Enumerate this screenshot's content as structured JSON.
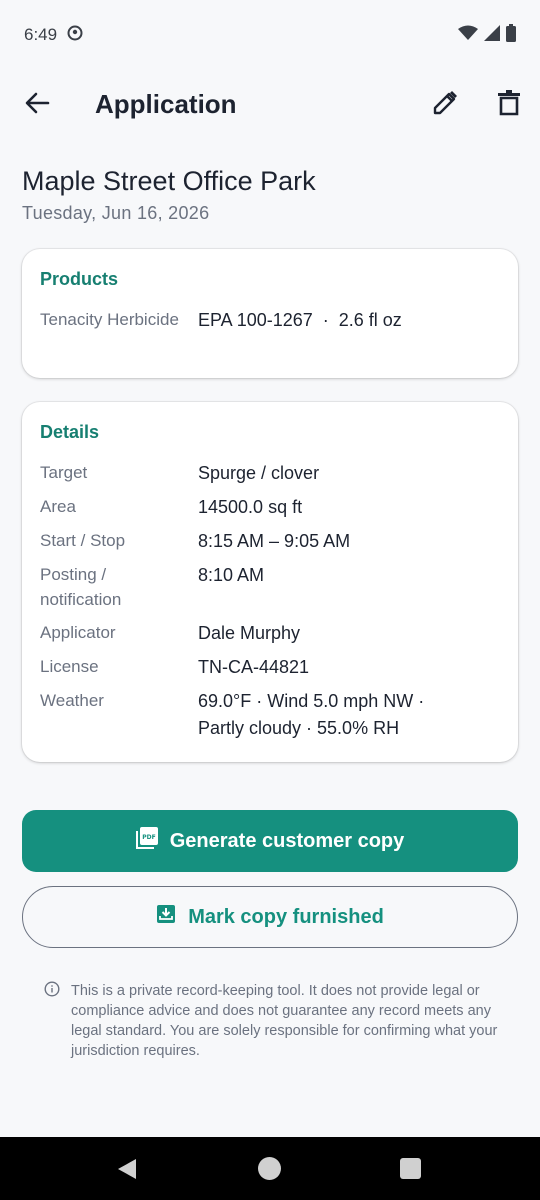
{
  "status_bar": {
    "time": "6:49",
    "icons": [
      "face-icon",
      "wifi-icon",
      "signal-icon",
      "battery-icon"
    ]
  },
  "app_bar": {
    "title": "Application",
    "icons": [
      "back-arrow-icon",
      "edit-pencil-icon",
      "trash-icon"
    ]
  },
  "header": {
    "site": "Maple Street Office Park",
    "date": "Tuesday, Jun 16, 2026"
  },
  "products": {
    "title": "Products",
    "items": [
      {
        "label": "Tenacity Herbicide",
        "value": "EPA 100-1267  ·  2.6 fl oz"
      }
    ]
  },
  "details": {
    "title": "Details",
    "rows": [
      {
        "label": "Target",
        "value": "Spurge / clover"
      },
      {
        "label": "Area",
        "value": "14500.0 sq ft"
      },
      {
        "label": "Start / Stop",
        "value": "8:15 AM – 9:05 AM"
      },
      {
        "label": "Posting / notification",
        "value": "8:10 AM"
      },
      {
        "label": "Applicator",
        "value": "Dale Murphy"
      },
      {
        "label": "License",
        "value": "TN-CA-44821"
      },
      {
        "label": "Weather",
        "value": "69.0°F · Wind 5.0 mph NW · Partly cloudy · 55.0% RH"
      }
    ]
  },
  "actions": {
    "generate_label": "Generate customer copy",
    "generate_icon": "pdf-icon",
    "furnished_label": "Mark copy furnished",
    "furnished_icon": "mark-furnished-icon"
  },
  "disclaimer": "This is a private record-keeping tool. It does not provide legal or compliance advice and does not guarantee any record meets any legal standard. You are solely responsible for confirming what your jurisdiction requires.",
  "colors": {
    "accent": "#15907f",
    "accent_text": "#167f71",
    "background": "#f7f8fa",
    "nav_bar": "#000000"
  }
}
